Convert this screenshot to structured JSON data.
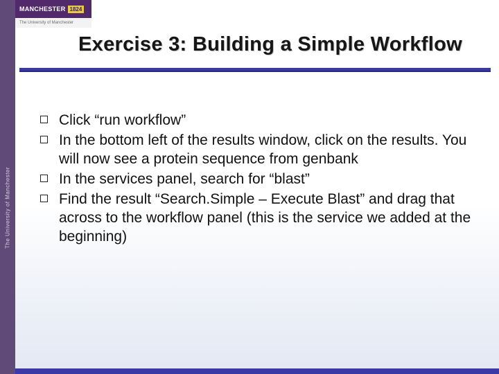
{
  "branding": {
    "sidebar_text": "The University of Manchester",
    "logo_name": "MANCHESTER",
    "logo_year": "1824",
    "logo_subtitle": "The University of Manchester"
  },
  "slide": {
    "title": "Exercise 3: Building a Simple Workflow",
    "bullets": [
      "Click “run workflow”",
      "In the bottom left of the results window, click on the results. You will now see a protein sequence from genbank",
      "In the services panel, search for “blast”",
      "Find the result “Search.Simple – Execute Blast” and drag that across to the workflow panel (this is the service we added at the beginning)"
    ]
  }
}
